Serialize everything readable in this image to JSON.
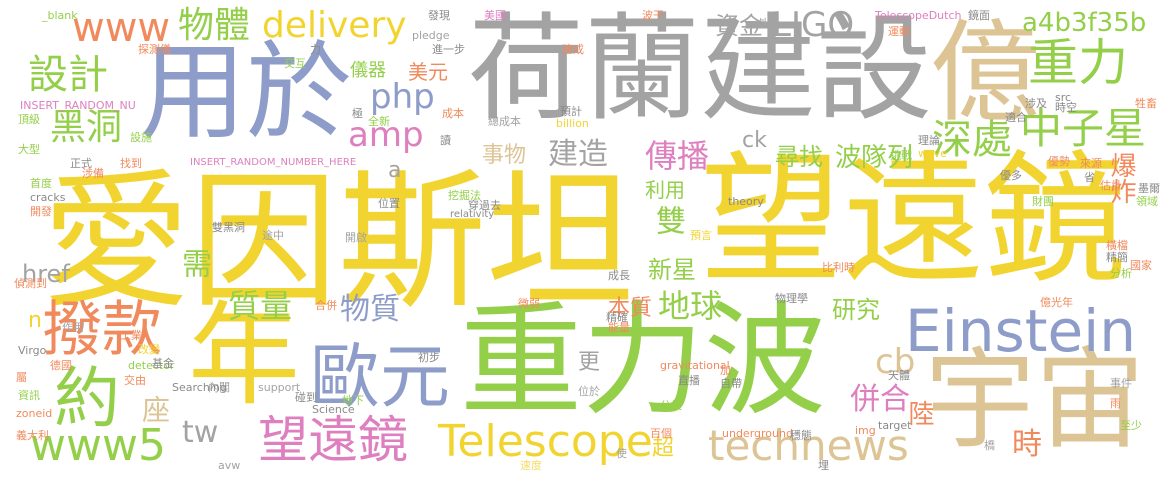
{
  "palette": {
    "yellow": "#f2d431",
    "lime": "#94cf4a",
    "gray": "#a3a3a3",
    "blue": "#8d9cc9",
    "tan": "#dcc494",
    "teal": "#6fc7a4",
    "orange": "#f08a5d",
    "pink": "#de7fbf",
    "lightyellow": "#f3dd6a",
    "darkgray": "#8a8a8a"
  },
  "words": [
    "愛因斯坦",
    "望遠鏡",
    "重力波",
    "荷蘭建設",
    "用於",
    "億",
    "宇宙",
    "年",
    "Einstein",
    "歐元",
    "撥款",
    "約",
    "望遠鏡",
    "Telescope",
    "technews",
    "www5",
    "重力",
    "中子星",
    "深處",
    "傳播",
    "設計",
    "黑洞",
    "www",
    "物體",
    "delivery",
    "LIGO",
    "資金",
    "a4b3f35b",
    "php",
    "amp",
    "建造",
    "事物",
    "尋找",
    "波隊列",
    "爆炸",
    "雙",
    "新星",
    "利用",
    "需",
    "href",
    "質量",
    "物質",
    "地球",
    "研究",
    "本質",
    "併合",
    "陸",
    "時",
    "座",
    "tw",
    "cb",
    "美元",
    "儀器",
    "ck",
    "超",
    "更",
    "n",
    "a"
  ],
  "small_words": [
    "_blank",
    "發現",
    "美國",
    "波干",
    "外",
    "TelescopeDutch",
    "鏡面",
    "運動",
    "探測儀",
    "力",
    "進一步",
    "pledge",
    "建成",
    "交互",
    "INSERT_RANDOM_NU",
    "預計",
    "billion",
    "成本",
    "總成本",
    "全新",
    "頂級",
    "極",
    "設施",
    "src",
    "時空",
    "涉及",
    "牲畜",
    "大型",
    "正式",
    "找到",
    "INSERT_RANDOM_NUMBER_HERE",
    "挑戰",
    "讀",
    "理論",
    "優勢",
    "wave",
    "涉備",
    "首度",
    "cracks",
    "開發",
    "挖掘法",
    "位置",
    "穿過去",
    "relativity",
    "theory",
    "財團",
    "領域",
    "分析",
    "國家",
    "雙黑洞",
    "途中",
    "開啟",
    "預言",
    "比利時",
    "偵測到",
    "成長",
    "物理學",
    "億光年",
    "合併",
    "作用",
    "微弱",
    "精確",
    "能量",
    "適合",
    "Virgo",
    "德國",
    "detector",
    "改變",
    "工業",
    "初步",
    "gravitational",
    "加",
    "天體",
    "基金",
    "交由",
    "資訊",
    "內閣",
    "Searching",
    "碰到",
    "support",
    "Science",
    "地下",
    "位於",
    "直播",
    "自帶",
    "公尺",
    "underground",
    "百個",
    "穩態",
    "img",
    "target",
    "事件",
    "zoneid",
    "avw",
    "速度",
    "埋",
    "雨",
    "至少",
    "義大利",
    "屬",
    "估計",
    "墨爾",
    "優多",
    "來源",
    "省",
    "橫檔",
    "精簡",
    "使",
    "橋"
  ]
}
